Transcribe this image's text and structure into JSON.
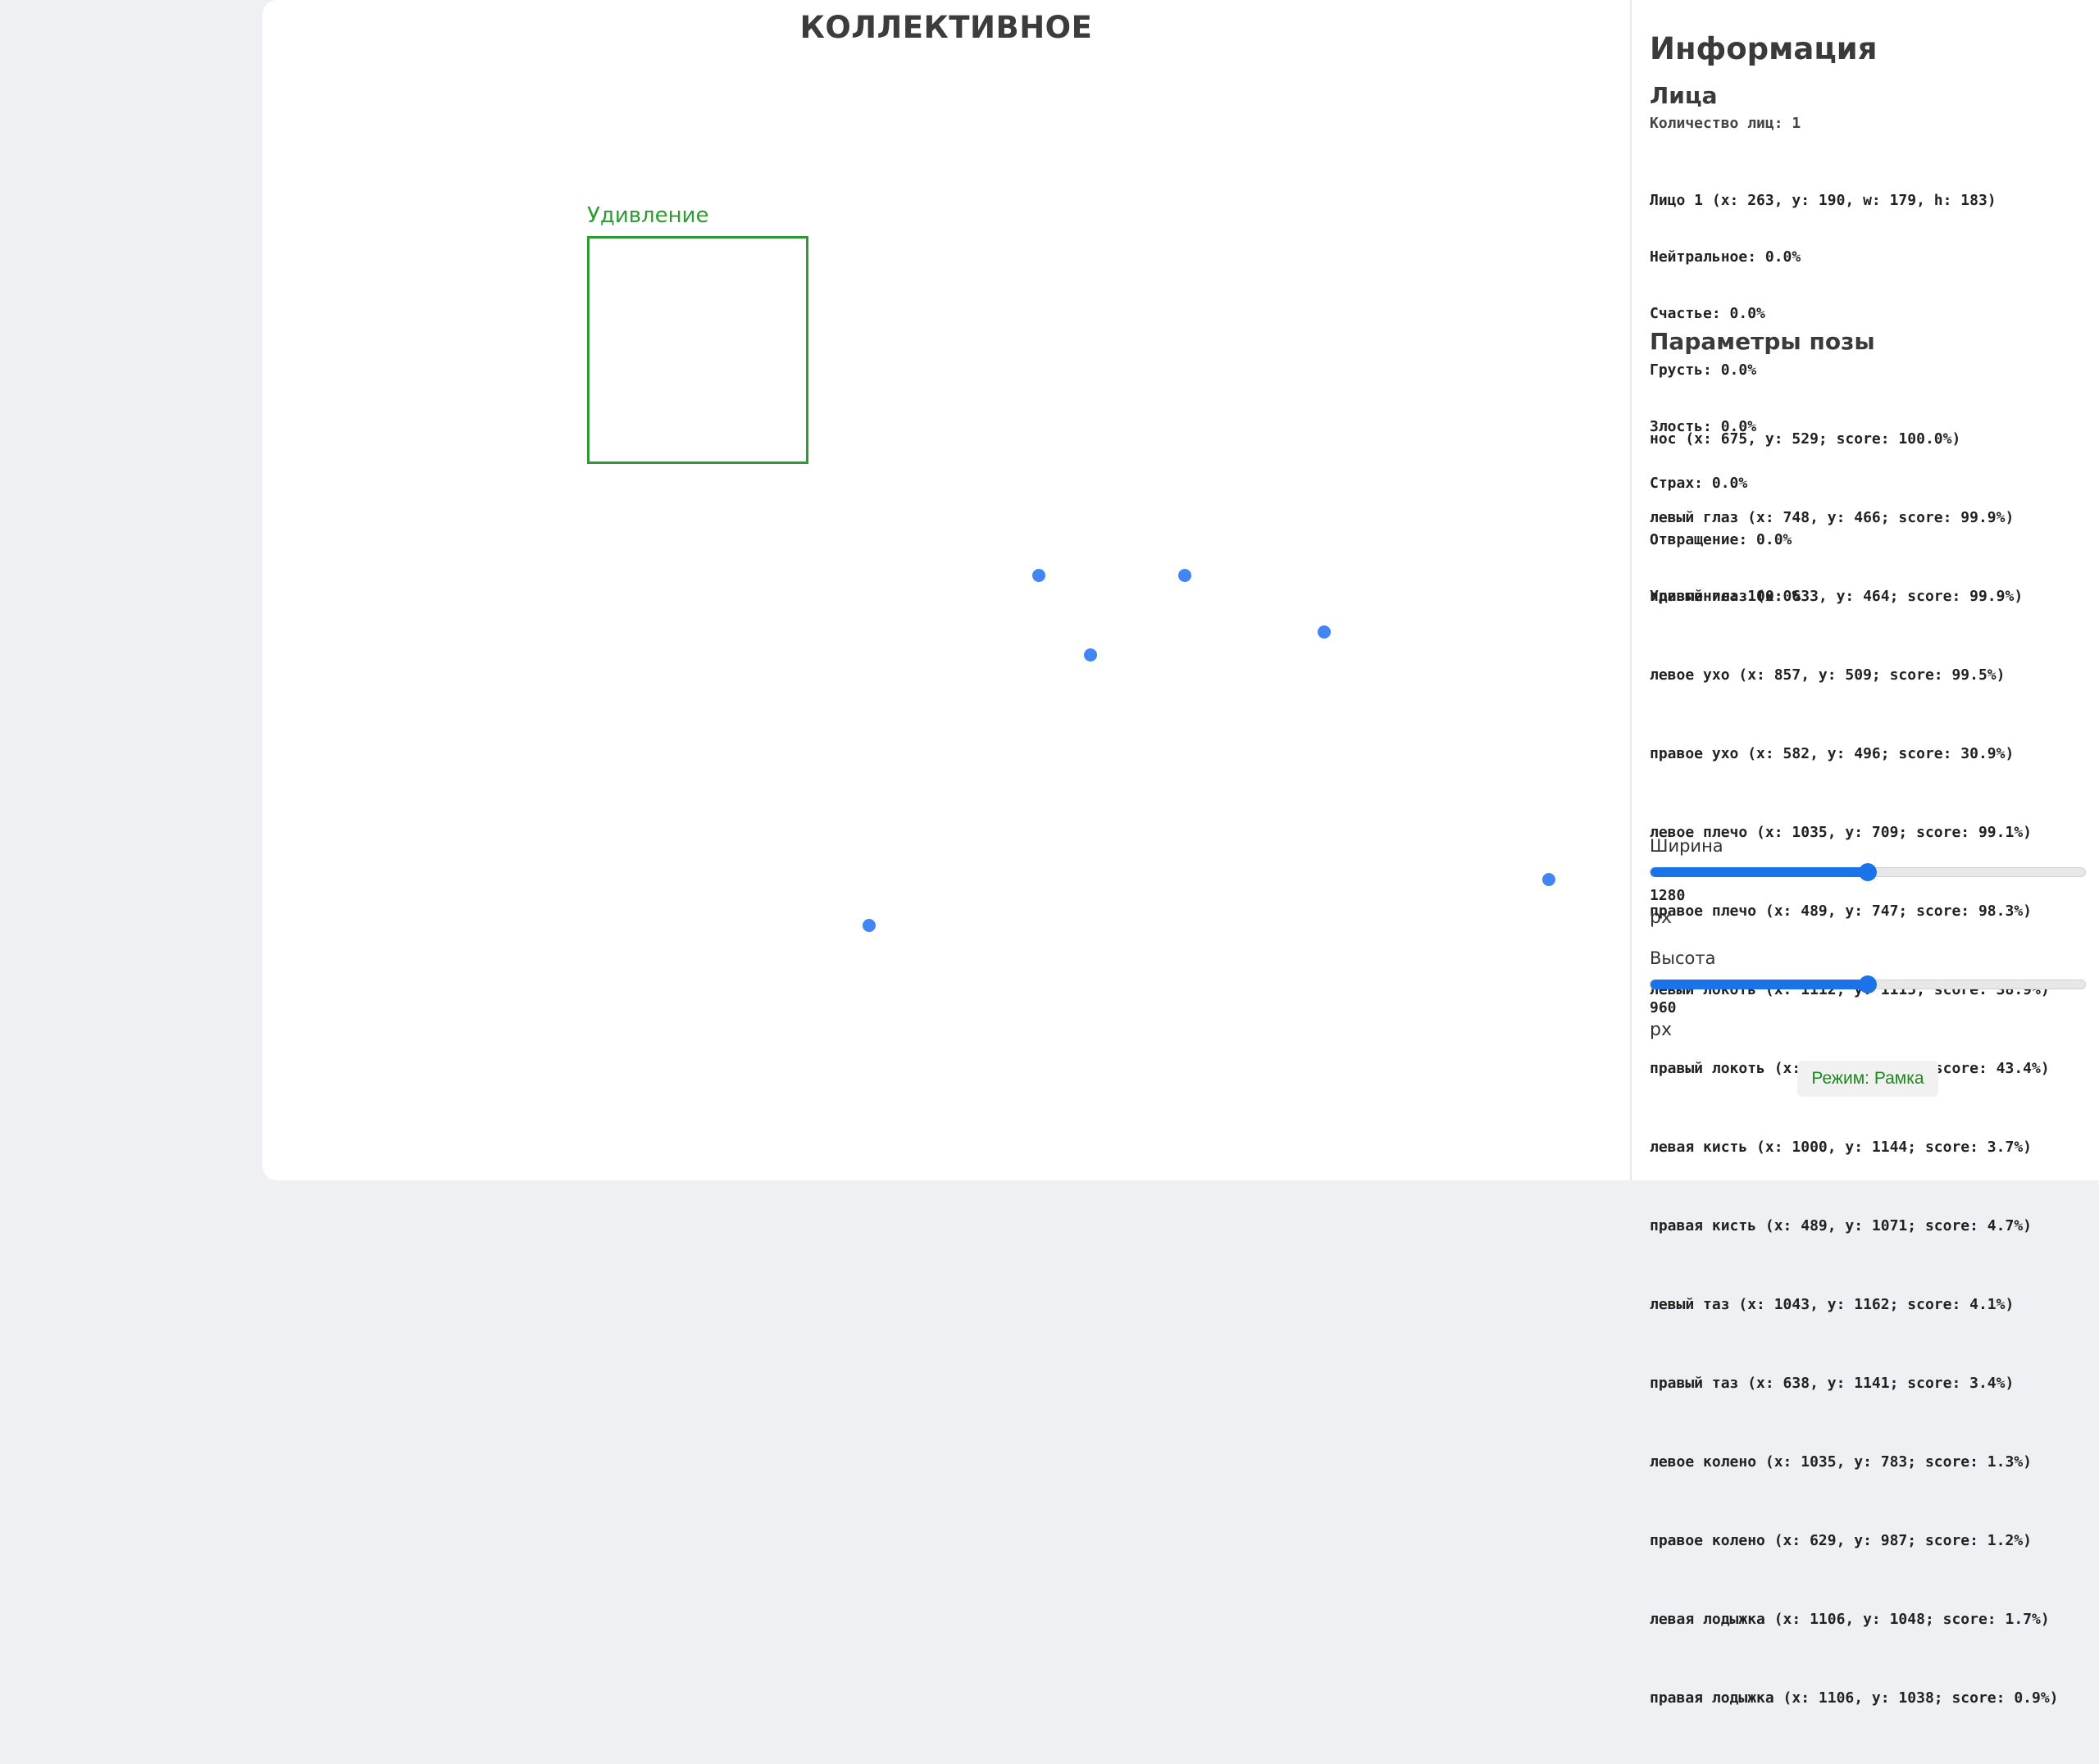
{
  "main": {
    "title": "КОЛЛЕКТИВНОЕ",
    "face_box_label": "Удивление",
    "keypoint_color": "#4285f4",
    "face_box_color": "#2e9a33"
  },
  "panel": {
    "title": "Информация",
    "faces_heading": "Лица",
    "faces_count": "Количество лиц: 1",
    "face_lines": [
      "Лицо 1 (x: 263, y: 190, w: 179, h: 183)",
      "Нейтральное: 0.0%",
      "Счастье: 0.0%",
      "Грусть: 0.0%",
      "Злость: 0.0%",
      "Страх: 0.0%",
      "Отвращение: 0.0%",
      "Удивление: 100.0%"
    ],
    "pose_heading": "Параметры позы",
    "pose_lines": [
      "нос (x: 675, y: 529; score: 100.0%)",
      "левый глаз (x: 748, y: 466; score: 99.9%)",
      "правый глаз (x: 633, y: 464; score: 99.9%)",
      "левое ухо (x: 857, y: 509; score: 99.5%)",
      "правое ухо (x: 582, y: 496; score: 30.9%)",
      "левое плечо (x: 1035, y: 709; score: 99.1%)",
      "правое плечо (x: 489, y: 747; score: 98.3%)",
      "левый локоть (x: 1112, y: 1115; score: 38.9%)",
      "правый локоть (x: 395, y: 1097; score: 43.4%)",
      "левая кисть (x: 1000, y: 1144; score: 3.7%)",
      "правая кисть (x: 489, y: 1071; score: 4.7%)",
      "левый таз (x: 1043, y: 1162; score: 4.1%)",
      "правый таз (x: 638, y: 1141; score: 3.4%)",
      "левое колено (x: 1035, y: 783; score: 1.3%)",
      "правое колено (x: 629, y: 987; score: 1.2%)",
      "левая лодыжка (x: 1106, y: 1048; score: 1.7%)",
      "правая лодыжка (x: 1106, y: 1038; score: 0.9%)"
    ],
    "width_slider": {
      "label": "Ширина",
      "value": "1280",
      "unit": "px",
      "fraction": 0.5
    },
    "height_slider": {
      "label": "Высота",
      "value": "960",
      "unit": "px",
      "fraction": 0.5
    },
    "mode_button_label": "Режим: Рамка",
    "accent_color": "#1a73e8"
  }
}
